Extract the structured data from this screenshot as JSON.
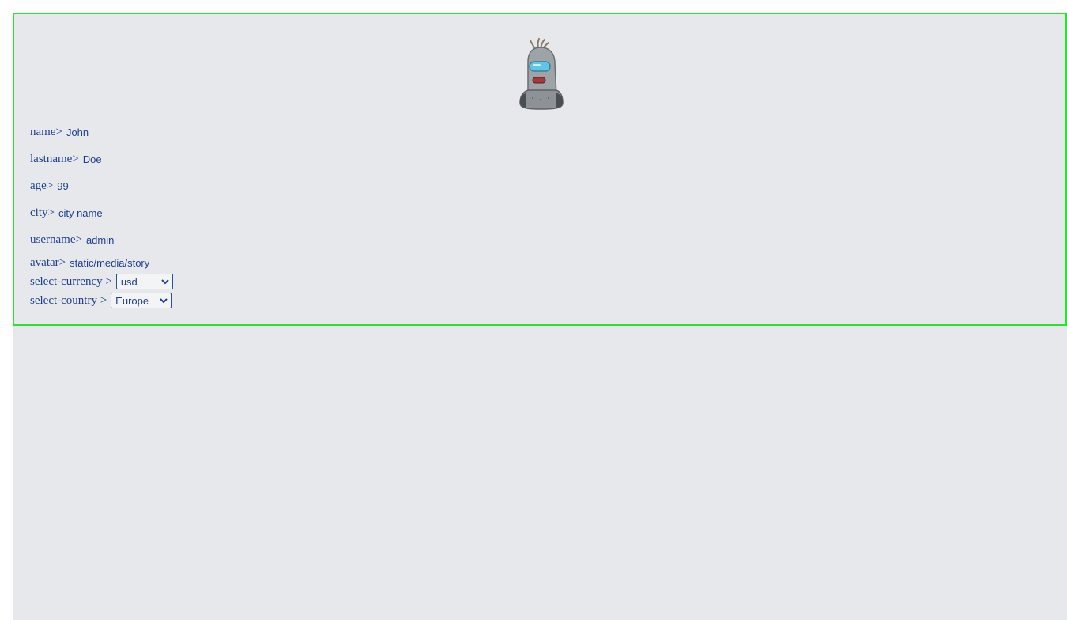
{
  "profile": {
    "fields": [
      {
        "label": "name>",
        "value": "John"
      },
      {
        "label": "lastname>",
        "value": "Doe"
      },
      {
        "label": "age>",
        "value": "99"
      },
      {
        "label": "city>",
        "value": "city name"
      },
      {
        "label": "username>",
        "value": "admin"
      },
      {
        "label": "avatar>",
        "value": "static/media/story"
      }
    ],
    "currency": {
      "label": "select-currency >",
      "selected": "usd"
    },
    "country": {
      "label": "select-country >",
      "selected": "Europe"
    }
  },
  "colors": {
    "panel_border": "#33dd33",
    "background": "#e7e8eb",
    "text": "#1f3f95"
  },
  "icons": {
    "avatar": "robot-avatar-icon",
    "dropdown": "chevron-down-icon"
  }
}
